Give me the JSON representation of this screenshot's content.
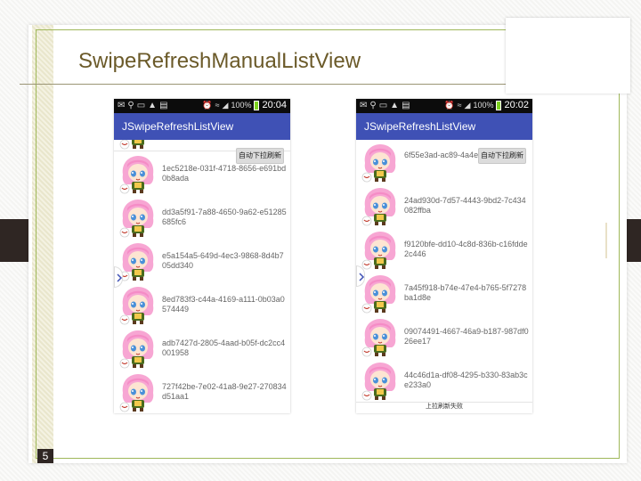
{
  "slide": {
    "title": "SwipeRefreshManualListView",
    "page_number": "5"
  },
  "phones": [
    {
      "status": {
        "battery": "100%",
        "time": "20:04"
      },
      "app_title": "JSwipeRefreshListView",
      "refresh_button": "自动下拉刷新",
      "rows": [
        "",
        "1ec5218e-031f-4718-8656-e691bd0b8ada",
        "dd3a5f91-7a88-4650-9a62-e51285685fc6",
        "e5a154a5-649d-4ec3-9868-8d4b705dd340",
        "8ed783f3-c44a-4169-a111-0b03a0574449",
        "adb7427d-2805-4aad-b05f-dc2cc4001958",
        "727f42be-7e02-41a8-9e27-270834d51aa1"
      ]
    },
    {
      "status": {
        "battery": "100%",
        "time": "20:02"
      },
      "app_title": "JSwipeRefreshListView",
      "refresh_button": "自动下拉刷新",
      "rows": [
        "6f55e3ad-ac89-4a4e-8ea6-8cf4",
        "24ad930d-7d57-4443-9bd2-7c434082ffba",
        "f9120bfe-dd10-4c8d-836b-c16fdde2c446",
        "7a45f918-b74e-47e4-b765-5f7278ba1d8e",
        "09074491-4667-46a9-b187-987df026ee17",
        "44c46d1a-df08-4295-b330-83ab3ce233a0"
      ],
      "footer": "上拉刷新失败"
    }
  ],
  "colors": {
    "appbar": "#3f51b5",
    "statusbar": "#0c0c0c",
    "title_text": "#6b5a29",
    "accent_dark": "#2f2623"
  }
}
